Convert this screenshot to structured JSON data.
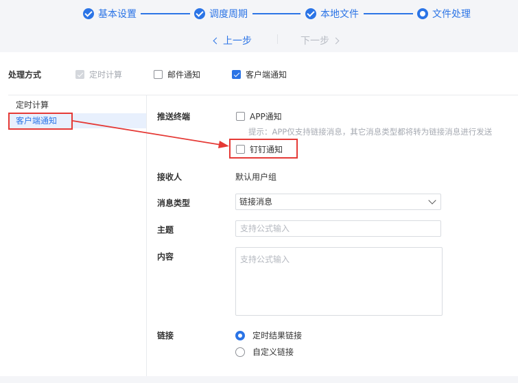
{
  "steps": [
    {
      "label": "基本设置",
      "state": "done"
    },
    {
      "label": "调度周期",
      "state": "done"
    },
    {
      "label": "本地文件",
      "state": "done"
    },
    {
      "label": "文件处理",
      "state": "current"
    }
  ],
  "nav": {
    "prev": "上一步",
    "next": "下一步"
  },
  "method": {
    "label": "处理方式",
    "options": [
      {
        "label": "定时计算",
        "checked": true,
        "disabled": true
      },
      {
        "label": "邮件通知",
        "checked": false
      },
      {
        "label": "客户端通知",
        "checked": true
      }
    ]
  },
  "sidebar": {
    "items": [
      {
        "label": "定时计算",
        "active": false
      },
      {
        "label": "客户端通知",
        "active": true
      }
    ]
  },
  "form": {
    "push_label": "推送终端",
    "app_notify": "APP通知",
    "hint": "提示：APP仅支持链接消息，其它消息类型都将转为链接消息进行发送",
    "dingtalk_notify": "钉钉通知",
    "receiver_label": "接收人",
    "receiver_value": "默认用户组",
    "msgtype_label": "消息类型",
    "msgtype_value": "链接消息",
    "subject_label": "主题",
    "subject_placeholder": "支持公式输入",
    "content_label": "内容",
    "content_placeholder": "支持公式输入",
    "link_label": "链接",
    "link_options": [
      {
        "label": "定时结果链接",
        "checked": true
      },
      {
        "label": "自定义链接",
        "checked": false
      }
    ]
  },
  "annotation_color": "#e53935",
  "accent": "#2b74e6"
}
